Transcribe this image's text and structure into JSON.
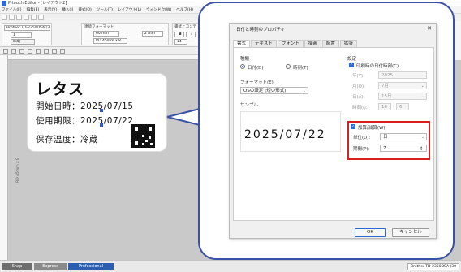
{
  "window": {
    "title": "P-touch Editor - [レイアウト2]"
  },
  "menu": [
    "ファイル(F)",
    "編集(E)",
    "表示(V)",
    "挿入(I)",
    "書式(O)",
    "ツール(T)",
    "レイアウト(L)",
    "ウィンドウ(W)",
    "ヘルプ(H)"
  ],
  "properties": {
    "printer": "Brother TD-2350DSA (300 dpi)",
    "paper_format": "連続フォーマット",
    "width": "60 mm",
    "margin": "2 mm",
    "copies": "1",
    "print_button": "印刷",
    "media": "RD 45mm x 8",
    "text_section": "書式とコンテ",
    "font_size": "14"
  },
  "label": {
    "title": "レタス",
    "row1": "開始日時：2025/07/15",
    "row2": "使用期限：2025/07/22",
    "row3": "保存温度：冷蔵",
    "vertical": "RD 45mm x 8"
  },
  "dialog": {
    "title": "日付と時刻のプロパティ",
    "close": "✕",
    "tabs": [
      "書式",
      "テキスト",
      "フォント",
      "描画",
      "配置",
      "拡張"
    ],
    "kind_label": "種類",
    "kind_date": "日付(D)",
    "kind_time": "時刻(T)",
    "format_label": "フォーマット(E):",
    "format_value": "OSの設定 (短い形式)",
    "sample_label": "サンプル",
    "sample_value": "2025/07/22",
    "settings_label": "設定",
    "print_time_label": "印刷時の日付時刻(C)",
    "year_label": "年(Y):",
    "year_value": "2025",
    "month_label": "月(O):",
    "month_value": "7月",
    "day_label": "日(A):",
    "day_value": "15日",
    "time_label": "時刻(I):",
    "time_hour": "16",
    "time_min": "6",
    "addsub_label": "加算/減算(W)",
    "unit_label": "単位(U):",
    "unit_value": "日",
    "period_label": "期間(P):",
    "period_value": "7",
    "ok": "OK",
    "cancel": "キャンセル"
  },
  "status": {
    "snap": "Snap",
    "express": "Express",
    "professional": "Professional",
    "printer": "Brother TD-2350DSA (30"
  },
  "colors": {
    "accent": "#2a6ad8",
    "callout": "#3850a8",
    "highlight": "#d81e1e",
    "pro_tab": "#2c5fb0"
  }
}
